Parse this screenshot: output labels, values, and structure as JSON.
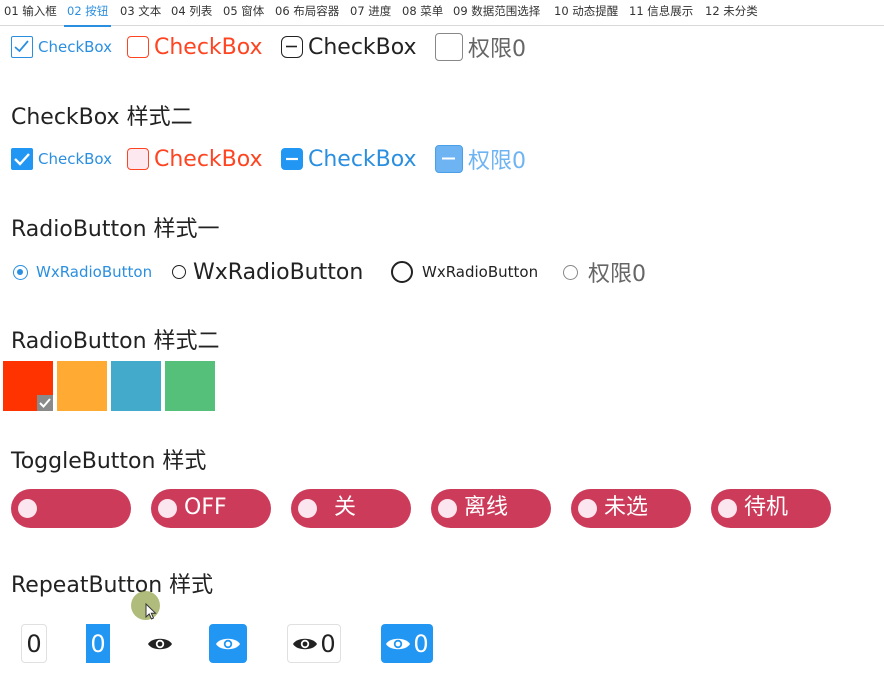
{
  "tabs": [
    "01 输入框",
    "02 按钮",
    "03 文本",
    "04 列表",
    "05 窗体",
    "06 布局容器",
    "07 进度",
    "08 菜单",
    "09 数据范围选择",
    "10 动态提醒",
    "11 信息展示",
    "12 未分类"
  ],
  "active_tab": "02 按钮",
  "checkbox_style1": [
    "CheckBox",
    "CheckBox",
    "CheckBox",
    "权限0"
  ],
  "checkbox_style2": {
    "heading": "CheckBox 样式二",
    "items": [
      "CheckBox",
      "CheckBox",
      "CheckBox",
      "权限0"
    ]
  },
  "radio_style1": {
    "heading": "RadioButton 样式一",
    "items": [
      "WxRadioButton",
      "WxRadioButton",
      "WxRadioButton",
      "权限0"
    ]
  },
  "radio_style2": {
    "heading": "RadioButton 样式二",
    "swatch_colors": [
      "#ff3300",
      "#ffaa33",
      "#44aacc",
      "#55c07a"
    ],
    "checked_index": 0
  },
  "toggle": {
    "heading": "ToggleButton 样式",
    "labels": [
      "",
      "OFF",
      "关",
      "离线",
      "未选",
      "待机"
    ],
    "color": "#cc3b5a"
  },
  "repeat": {
    "heading": "RepeatButton 样式",
    "values": [
      "0",
      "0",
      "0",
      "0"
    ]
  },
  "colors": {
    "accent": "#2196f3",
    "danger": "#ff4422"
  }
}
